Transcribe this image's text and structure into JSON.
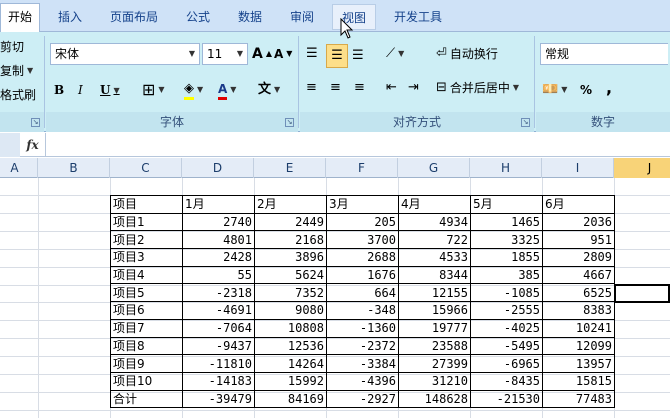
{
  "tabs": [
    "开始",
    "插入",
    "页面布局",
    "公式",
    "数据",
    "审阅",
    "视图",
    "开发工具"
  ],
  "active_tab": "开始",
  "clipboard": {
    "cut": "剪切",
    "copy": "复制",
    "format_painter": "格式刷"
  },
  "font": {
    "name": "宋体",
    "size": "11",
    "grow": "A",
    "shrink": "A",
    "bold": "B",
    "italic": "I",
    "underline": "U",
    "font_color_letter": "A",
    "phonetic": "文",
    "group_label": "字体"
  },
  "alignment": {
    "wrap_text": "自动换行",
    "merge_center": "合并后居中",
    "group_label": "对齐方式"
  },
  "number": {
    "format": "常规",
    "percent": "%",
    "comma": ",",
    "group_label": "数字"
  },
  "formula_bar": {
    "fx": "fx",
    "content": ""
  },
  "columns": [
    "A",
    "B",
    "C",
    "D",
    "E",
    "F",
    "G",
    "H",
    "I",
    "J"
  ],
  "active_column": "J",
  "table": {
    "header": [
      "项目",
      "1月",
      "2月",
      "3月",
      "4月",
      "5月",
      "6月"
    ],
    "rows": [
      [
        "项目1",
        "2740",
        "2449",
        "205",
        "4934",
        "1465",
        "2036"
      ],
      [
        "项目2",
        "4801",
        "2168",
        "3700",
        "722",
        "3325",
        "951"
      ],
      [
        "项目3",
        "2428",
        "3896",
        "2688",
        "4533",
        "1855",
        "2809"
      ],
      [
        "项目4",
        "55",
        "5624",
        "1676",
        "8344",
        "385",
        "4667"
      ],
      [
        "项目5",
        "-2318",
        "7352",
        "664",
        "12155",
        "-1085",
        "6525"
      ],
      [
        "项目6",
        "-4691",
        "9080",
        "-348",
        "15966",
        "-2555",
        "8383"
      ],
      [
        "项目7",
        "-7064",
        "10808",
        "-1360",
        "19777",
        "-4025",
        "10241"
      ],
      [
        "项目8",
        "-9437",
        "12536",
        "-2372",
        "23588",
        "-5495",
        "12099"
      ],
      [
        "项目9",
        "-11810",
        "14264",
        "-3384",
        "27399",
        "-6965",
        "13957"
      ],
      [
        "项目10",
        "-14183",
        "15992",
        "-4396",
        "31210",
        "-8435",
        "15815"
      ],
      [
        "合计",
        "-39479",
        "84169",
        "-2927",
        "148628",
        "-21530",
        "77483"
      ]
    ]
  },
  "colors": {
    "ribbon": "#cdeef5",
    "tabbar": "#cfe2f7",
    "selected_button": "#fddf8a",
    "active_col": "#f8d378"
  }
}
